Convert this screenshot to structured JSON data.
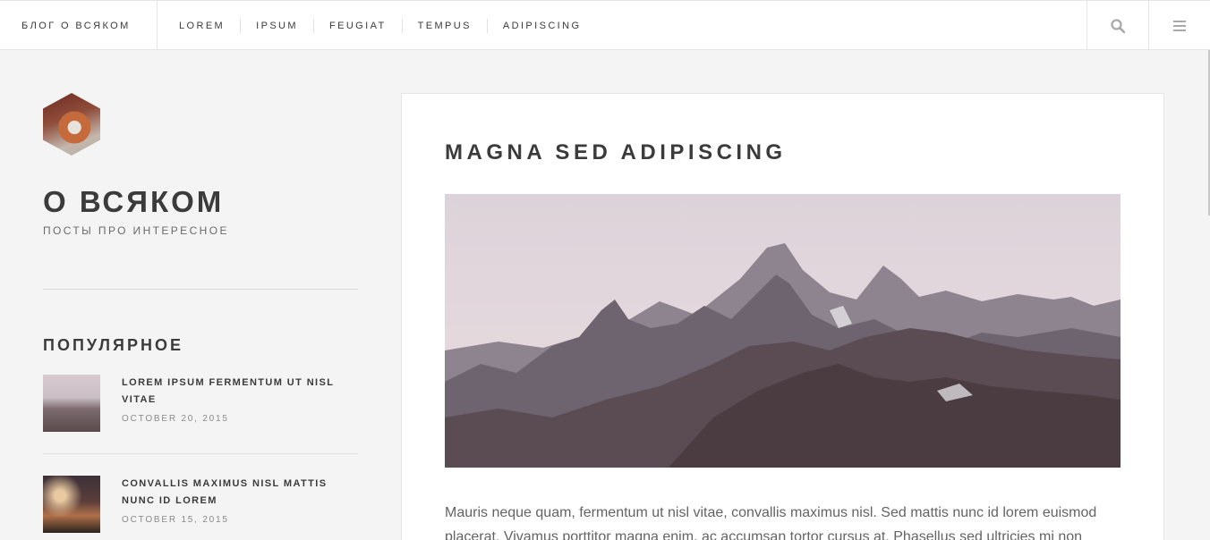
{
  "header": {
    "brand": "БЛОГ О ВСЯКОМ",
    "nav": [
      "LOREM",
      "IPSUM",
      "FEUGIAT",
      "TEMPUS",
      "ADIPISCING"
    ],
    "search_icon": "search-icon",
    "menu_icon": "hamburger-menu-icon"
  },
  "sidebar": {
    "logo": "fox-logo",
    "title": "О ВСЯКОМ",
    "subtitle": "ПОСТЫ ПРО ИНТЕРЕСНОЕ",
    "popular_title": "ПОПУЛЯРНОЕ",
    "posts": [
      {
        "title": "LOREM IPSUM FERMENTUM UT NISL VITAE",
        "date": "OCTOBER 20, 2015"
      },
      {
        "title": "CONVALLIS MAXIMUS NISL MATTIS NUNC ID LOREM",
        "date": "OCTOBER 15, 2015"
      }
    ]
  },
  "article": {
    "title": "MAGNA SED ADIPISCING",
    "image": "mountain-landscape-image",
    "body": "Mauris neque quam, fermentum ut nisl vitae, convallis maximus nisl. Sed mattis nunc id lorem euismod placerat. Vivamus porttitor magna enim, ac accumsan tortor cursus at. Phasellus sed ultricies mi non"
  },
  "colors": {
    "text": "#3c3b3b",
    "muted": "#8a8a8a",
    "bg": "#f4f4f4",
    "card": "#ffffff"
  }
}
